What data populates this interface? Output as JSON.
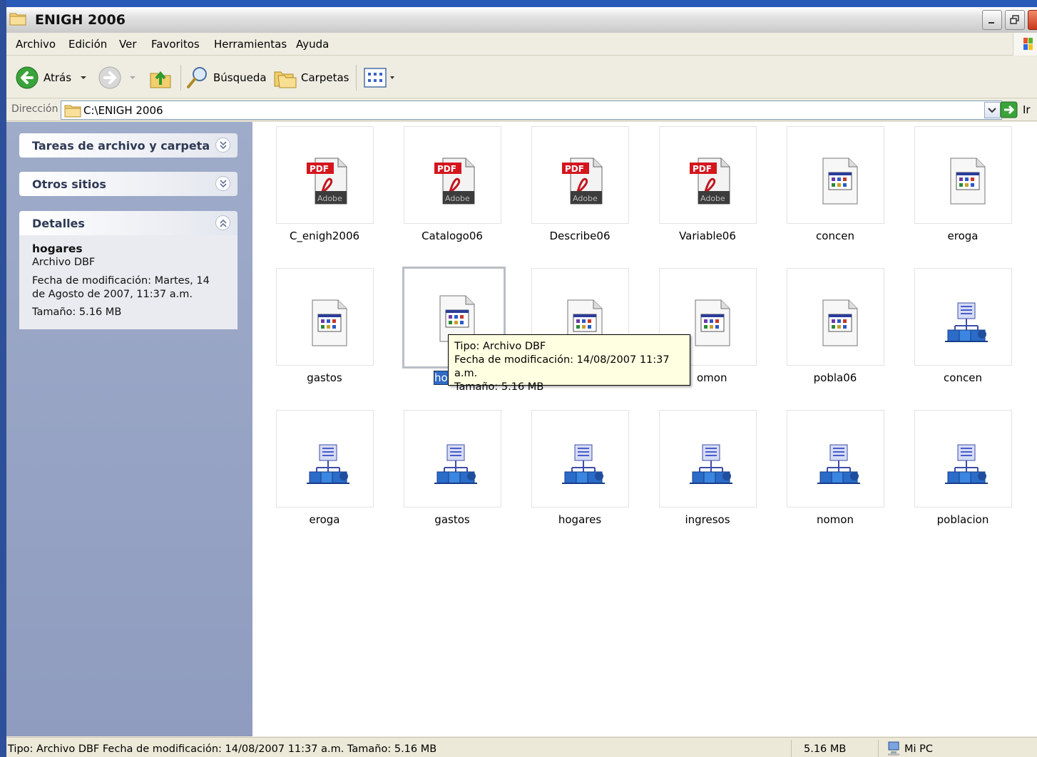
{
  "window": {
    "title": "ENIGH 2006"
  },
  "menu": [
    "Archivo",
    "Edición",
    "Ver",
    "Favoritos",
    "Herramientas",
    "Ayuda"
  ],
  "toolbar": {
    "back_label": "Atrás",
    "search_label": "Búsqueda",
    "folders_label": "Carpetas"
  },
  "address": {
    "label": "Dirección",
    "value": "C:\\ENIGH 2006",
    "go_label": "Ir"
  },
  "taskpane": {
    "tasks_title": "Tareas de archivo y carpeta",
    "other_title": "Otros sitios",
    "details_title": "Detalles",
    "details": {
      "name": "hogares",
      "type": "Archivo DBF",
      "modified": "Fecha de modificación: Martes, 14 de Agosto de 2007, 11:37 a.m.",
      "size": "Tamaño: 5.16 MB"
    }
  },
  "files": [
    {
      "name": "C_enigh2006",
      "kind": "pdf"
    },
    {
      "name": "Catalogo06",
      "kind": "pdf"
    },
    {
      "name": "Describe06",
      "kind": "pdf"
    },
    {
      "name": "Variable06",
      "kind": "pdf"
    },
    {
      "name": "concen",
      "kind": "dbf"
    },
    {
      "name": "eroga",
      "kind": "dbf"
    },
    {
      "name": "gastos",
      "kind": "dbf"
    },
    {
      "name": "hoga",
      "kind": "dbf",
      "selected": true
    },
    {
      "name": "",
      "kind": "dbf"
    },
    {
      "name": "omon",
      "kind": "dbf"
    },
    {
      "name": "pobla06",
      "kind": "dbf"
    },
    {
      "name": "concen",
      "kind": "net"
    },
    {
      "name": "eroga",
      "kind": "net"
    },
    {
      "name": "gastos",
      "kind": "net"
    },
    {
      "name": "hogares",
      "kind": "net"
    },
    {
      "name": "ingresos",
      "kind": "net"
    },
    {
      "name": "nomon",
      "kind": "net"
    },
    {
      "name": "poblacion",
      "kind": "net"
    }
  ],
  "tooltip": {
    "line1": "Tipo: Archivo DBF",
    "line2": "Fecha de modificación: 14/08/2007 11:37 a.m.",
    "line3": "Tamaño: 5.16 MB"
  },
  "status": {
    "info": "Tipo: Archivo DBF Fecha de modificación: 14/08/2007 11:37 a.m. Tamaño: 5.16 MB",
    "size": "5.16 MB",
    "location": "Mi PC"
  },
  "icons": {
    "folder": "folder-icon",
    "back": "back-arrow-icon",
    "forward": "forward-arrow-icon",
    "up": "up-folder-icon",
    "search": "search-magnifier-icon",
    "folders": "folders-icon",
    "views": "views-icon",
    "go": "go-arrow-icon",
    "pdf": "pdf-file-icon",
    "dbf": "dbf-file-icon",
    "net": "network-dataset-icon",
    "computer": "my-computer-icon"
  }
}
